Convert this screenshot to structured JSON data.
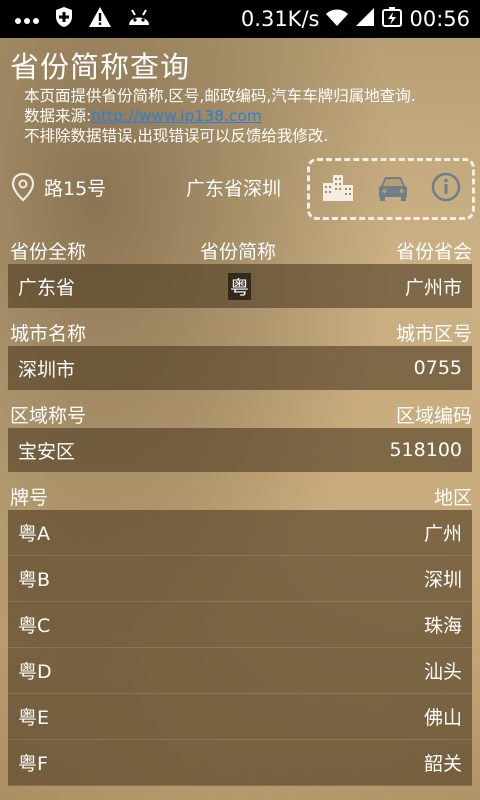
{
  "status_bar": {
    "speed": "0.31K/s",
    "time": "00:56",
    "icons": [
      "dots-icon",
      "shield-icon",
      "warning-icon",
      "android-icon",
      "wifi-icon",
      "signal-icon",
      "battery-charging-icon"
    ]
  },
  "header": {
    "title": "省份简称查询",
    "desc_line1": "本页面提供省份简称,区号,邮政编码,汽车车牌归属地查询.",
    "desc_line2_prefix": "数据来源:",
    "desc_link": "http://www.ip138.com",
    "desc_line3": "不排除数据错误,出现错误可以反馈给我修改."
  },
  "location": {
    "address": "路15号",
    "region": "广东省深圳",
    "icons": [
      "city-icon",
      "car-icon",
      "info-icon"
    ]
  },
  "province": {
    "label_full": "省份全称",
    "label_abbr": "省份简称",
    "label_capital": "省份省会",
    "full": "广东省",
    "abbr": "粤",
    "capital": "广州市"
  },
  "city": {
    "label_name": "城市名称",
    "label_code": "城市区号",
    "name": "深圳市",
    "code": "0755"
  },
  "district": {
    "label_name": "区域称号",
    "label_code": "区域编码",
    "name": "宝安区",
    "code": "518100"
  },
  "plates": {
    "label_plate": "牌号",
    "label_area": "地区",
    "rows": [
      {
        "plate": "粤A",
        "area": "广州"
      },
      {
        "plate": "粤B",
        "area": "深圳"
      },
      {
        "plate": "粤C",
        "area": "珠海"
      },
      {
        "plate": "粤D",
        "area": "汕头"
      },
      {
        "plate": "粤E",
        "area": "佛山"
      },
      {
        "plate": "粤F",
        "area": "韶关"
      }
    ]
  },
  "colors": {
    "link": "#2b7fd6",
    "row_bg": "#503e24",
    "status_bg": "#000000"
  }
}
